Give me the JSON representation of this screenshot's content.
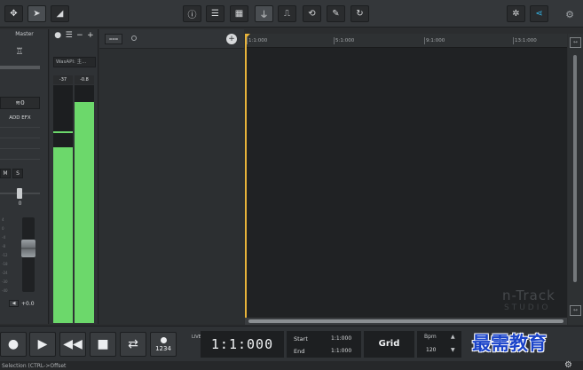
{
  "toolbar": {
    "icons": [
      "move-icon",
      "pointer-icon",
      "envelope-icon",
      "info-icon",
      "mixer-icon",
      "piano-roll-icon",
      "metronome-icon",
      "input-icon",
      "loop-icon",
      "tools-icon",
      "refresh-icon",
      "effects-icon",
      "share-icon",
      "settings-icon"
    ]
  },
  "master": {
    "title": "Master",
    "fx_label": "≋0",
    "add_efx_label": "ADD EFX",
    "mute_label": "M",
    "solo_label": "S",
    "pan_value": "0",
    "volume_value": "+0.0",
    "scale_ticks": [
      "4",
      "0",
      "-4",
      "-8",
      "-12",
      "-18",
      "-24",
      "-30",
      "-40"
    ]
  },
  "meter": {
    "input_device": "WasAPI: 主...",
    "peak_left": "-37",
    "peak_right": "-0.8",
    "level_left": 0.74,
    "level_right": 0.93
  },
  "tracks": {
    "filter_label": "⩶"
  },
  "ruler": {
    "labels": [
      "1:1:000",
      "5:1:000",
      "9:1:000",
      "13:1:000"
    ]
  },
  "watermark": {
    "title": "n-Track",
    "subtitle": "STUDIO"
  },
  "transport": {
    "count_in_label": "1234",
    "live_label": "LIVE",
    "time_display": "1:1:000",
    "start_label": "Start",
    "start_value": "1:1:000",
    "end_label": "End",
    "end_value": "1:1:000",
    "grid_label": "Grid",
    "bpm_label": "Bpm",
    "bpm_value": "120"
  },
  "status": {
    "text": "Selection (CTRL->Offset"
  },
  "brand_watermark": "最需教育",
  "colors": {
    "meter_green": "#6cd86b",
    "playhead": "#e7b33b",
    "share": "#35b6e8"
  }
}
